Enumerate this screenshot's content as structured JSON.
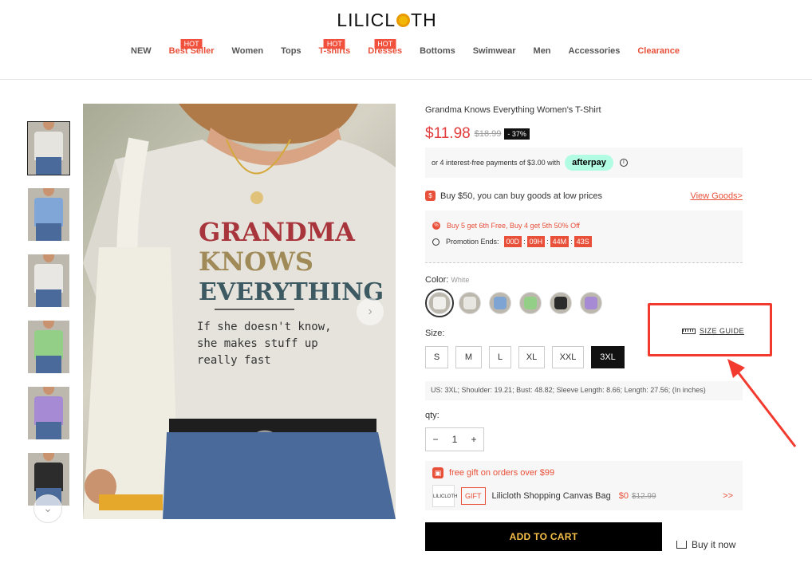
{
  "header": {
    "logo_left": "LILICL",
    "logo_right": "TH",
    "nav": [
      {
        "label": "NEW",
        "hot": "",
        "style": "normal"
      },
      {
        "label": "Best Seller",
        "hot": "HOT",
        "style": "red"
      },
      {
        "label": "Women",
        "hot": "",
        "style": "normal"
      },
      {
        "label": "Tops",
        "hot": "",
        "style": "normal"
      },
      {
        "label": "T-shirts",
        "hot": "HOT",
        "style": "red"
      },
      {
        "label": "Dresses",
        "hot": "HOT",
        "style": "red"
      },
      {
        "label": "Bottoms",
        "hot": "",
        "style": "normal"
      },
      {
        "label": "Swimwear",
        "hot": "",
        "style": "normal"
      },
      {
        "label": "Men",
        "hot": "",
        "style": "normal"
      },
      {
        "label": "Accessories",
        "hot": "",
        "style": "normal"
      },
      {
        "label": "Clearance",
        "hot": "",
        "style": "red"
      }
    ]
  },
  "gallery": {
    "thumbs": [
      {
        "color": "#e6e4df",
        "icon": "shirt-white-thumb"
      },
      {
        "color": "#7fa6d6",
        "icon": "shirt-blue-thumb"
      },
      {
        "color": "#e9e7e3",
        "icon": "shirt-white-thumb"
      },
      {
        "color": "#93cf86",
        "icon": "shirt-green-thumb"
      },
      {
        "color": "#a68ad3",
        "icon": "shirt-purple-thumb"
      },
      {
        "color": "#2c2c2c",
        "icon": "shirt-black-thumb"
      }
    ],
    "shirt_text_line1": "GRANDMA",
    "shirt_text_line2": "KNOWS",
    "shirt_text_line3": "EVERYTHING",
    "shirt_text_line4": "If she doesn't know,",
    "shirt_text_line5": "she makes stuff up",
    "shirt_text_line6": "really fast"
  },
  "product": {
    "title": "Grandma Knows Everything Women's T-Shirt",
    "price": "$11.98",
    "old_price": "$18.99",
    "discount": "- 37%",
    "payment_text": "or 4 interest-free payments of $3.00 with",
    "afterpay": "afterpay",
    "deal_text": "Buy $50, you can buy goods at low prices",
    "view_goods": "View Goods>",
    "promo_line": "Buy 5 get 6th Free, Buy 4 get 5th 50% Off",
    "promo_ends_label": "Promotion Ends:",
    "countdown": [
      "00D",
      "09H",
      "44M",
      "43S"
    ],
    "color_label": "Color:",
    "color_value": "White",
    "swatches": [
      "#f0efec",
      "#e8e6e1",
      "#7ea4d4",
      "#93cf86",
      "#2c2c2c",
      "#a68ad3"
    ],
    "size_label": "Size:",
    "size_guide": "SIZE GUIDE",
    "sizes": [
      "S",
      "M",
      "L",
      "XL",
      "XXL",
      "3XL"
    ],
    "selected_size": "3XL",
    "measurements": "US: 3XL;   Shoulder: 19.21;   Bust: 48.82;   Sleeve Length: 8.66;   Length: 27.56;   (In inches)",
    "qty_label": "qty:",
    "qty_minus": "−",
    "qty_value": "1",
    "qty_plus": "+",
    "gift_title": "free gift on orders over $99",
    "gift_badge": "GIFT",
    "gift_name": "Lilicloth Shopping Canvas Bag",
    "gift_price": "$0",
    "gift_old_price": "$12.99",
    "gift_more": ">>",
    "add_to_cart": "ADD TO CART",
    "buy_now": "Buy it now"
  },
  "annotation": {
    "color": "#f23b2e"
  }
}
